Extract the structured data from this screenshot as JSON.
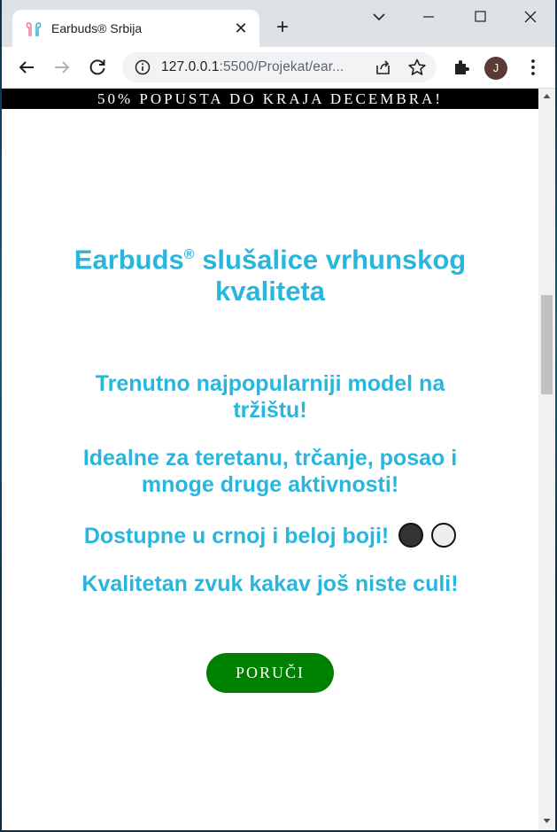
{
  "browser": {
    "tab_title": "Earbuds® Srbija",
    "tab_close": "✕",
    "new_tab": "+",
    "url_host": "127.0.0.1",
    "url_rest": ":5500/Projekat/ear...",
    "profile_initial": "J"
  },
  "page": {
    "banner": "50% POPUSTA DO KRAJA DECEMBRA!",
    "heading_main": "Earbuds",
    "heading_reg": "®",
    "heading_rest": " slušalice vrhunskog",
    "heading_line2": "kvaliteta",
    "line1a": "Trenutno najpopularniji model na",
    "line1b": "tržištu!",
    "line2a": "Idealne za teretanu, trčanje, posao i",
    "line2b": "mnoge druge aktivnosti!",
    "line3": "Dostupne u crnoj i beloj boji!",
    "line4": "Kvalitetan zvuk kakav još niste culi!",
    "order_button": "PORUČI",
    "colors": {
      "accent": "#29b6dc",
      "button": "#008000",
      "swatch_black": "#333333",
      "swatch_white": "#eeeeee"
    }
  }
}
